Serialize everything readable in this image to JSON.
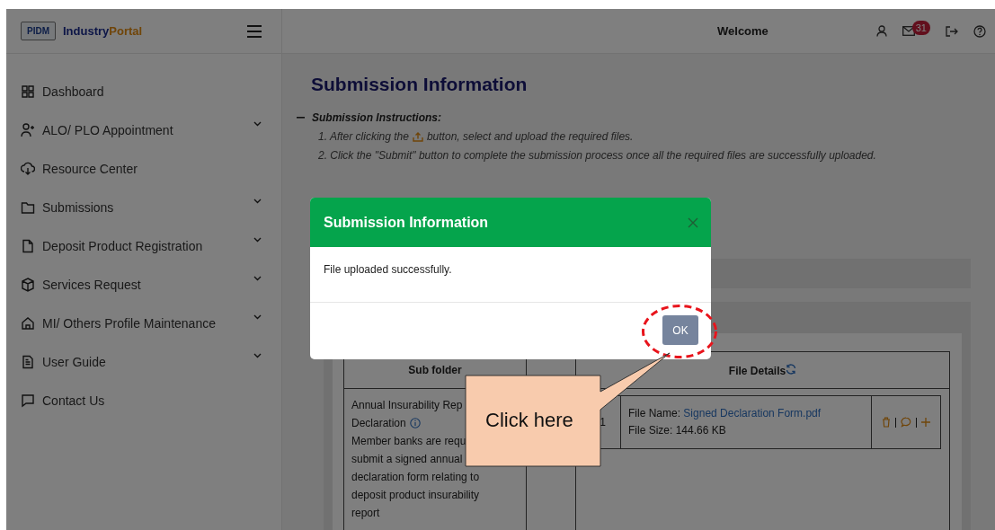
{
  "logo": {
    "badge": "PIDM",
    "name_part_1": "Industry",
    "name_part_2": "Portal"
  },
  "sidebar": {
    "items": [
      {
        "label": "Dashboard",
        "expandable": false
      },
      {
        "label": "ALO/ PLO Appointment",
        "expandable": true
      },
      {
        "label": "Resource Center",
        "expandable": false
      },
      {
        "label": "Submissions",
        "expandable": true
      },
      {
        "label": "Deposit Product Registration",
        "expandable": true
      },
      {
        "label": "Services Request",
        "expandable": true
      },
      {
        "label": "MI/ Others Profile Maintenance",
        "expandable": true
      },
      {
        "label": "User Guide",
        "expandable": true
      },
      {
        "label": "Contact Us",
        "expandable": false
      }
    ]
  },
  "header": {
    "title": "Welcome",
    "mail_count": "31"
  },
  "page": {
    "title": "Submission Information",
    "instructions_title": "Submission Instructions:",
    "step_1_before": "1. After clicking the",
    "step_1_after": "button, select and upload the required files.",
    "step_2": "2. Click the \"Submit\" button to complete the submission process once all the required files are successfully uploaded."
  },
  "table": {
    "columns": [
      "Sub folder",
      "File Details"
    ],
    "row": {
      "subfolder_lines": [
        "Annual Insurability Rep",
        "Declaration",
        "Member banks are requ",
        "submit a signed annual",
        "declaration form relating to",
        "deposit product insurability",
        "report"
      ],
      "file_index": "1",
      "file_name_label": "File Name:",
      "file_name": "Signed Declaration Form.pdf",
      "file_size": "File Size: 144.66 KB"
    }
  },
  "modal": {
    "title": "Submission Information",
    "message": "File uploaded successfully.",
    "ok_button": "OK"
  },
  "callout": {
    "text": "Click here"
  }
}
